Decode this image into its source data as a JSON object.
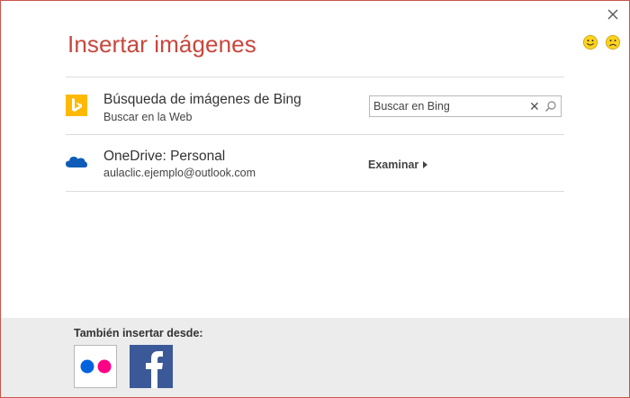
{
  "dialog": {
    "title": "Insertar imágenes",
    "feedback": {
      "happy_icon": "smile-icon",
      "sad_icon": "frown-icon"
    }
  },
  "sources": {
    "bing": {
      "title": "Búsqueda de imágenes de Bing",
      "subtitle": "Buscar en la Web",
      "search_placeholder": "Buscar en Bing",
      "search_value": ""
    },
    "onedrive": {
      "title": "OneDrive: Personal",
      "subtitle": "aulaclic.ejemplo@outlook.com",
      "browse_label": "Examinar"
    }
  },
  "footer": {
    "label": "También insertar desde:",
    "services": [
      {
        "name": "Flickr",
        "icon": "flickr-icon"
      },
      {
        "name": "Facebook",
        "icon": "facebook-icon"
      }
    ]
  },
  "colors": {
    "title": "#c8473d",
    "border": "#c8554a",
    "bing": "#ffb900",
    "onedrive": "#0f5cb8",
    "flickr_blue": "#0063dc",
    "flickr_pink": "#ff0084",
    "facebook": "#3b5998",
    "footer_bg": "#ececec"
  }
}
